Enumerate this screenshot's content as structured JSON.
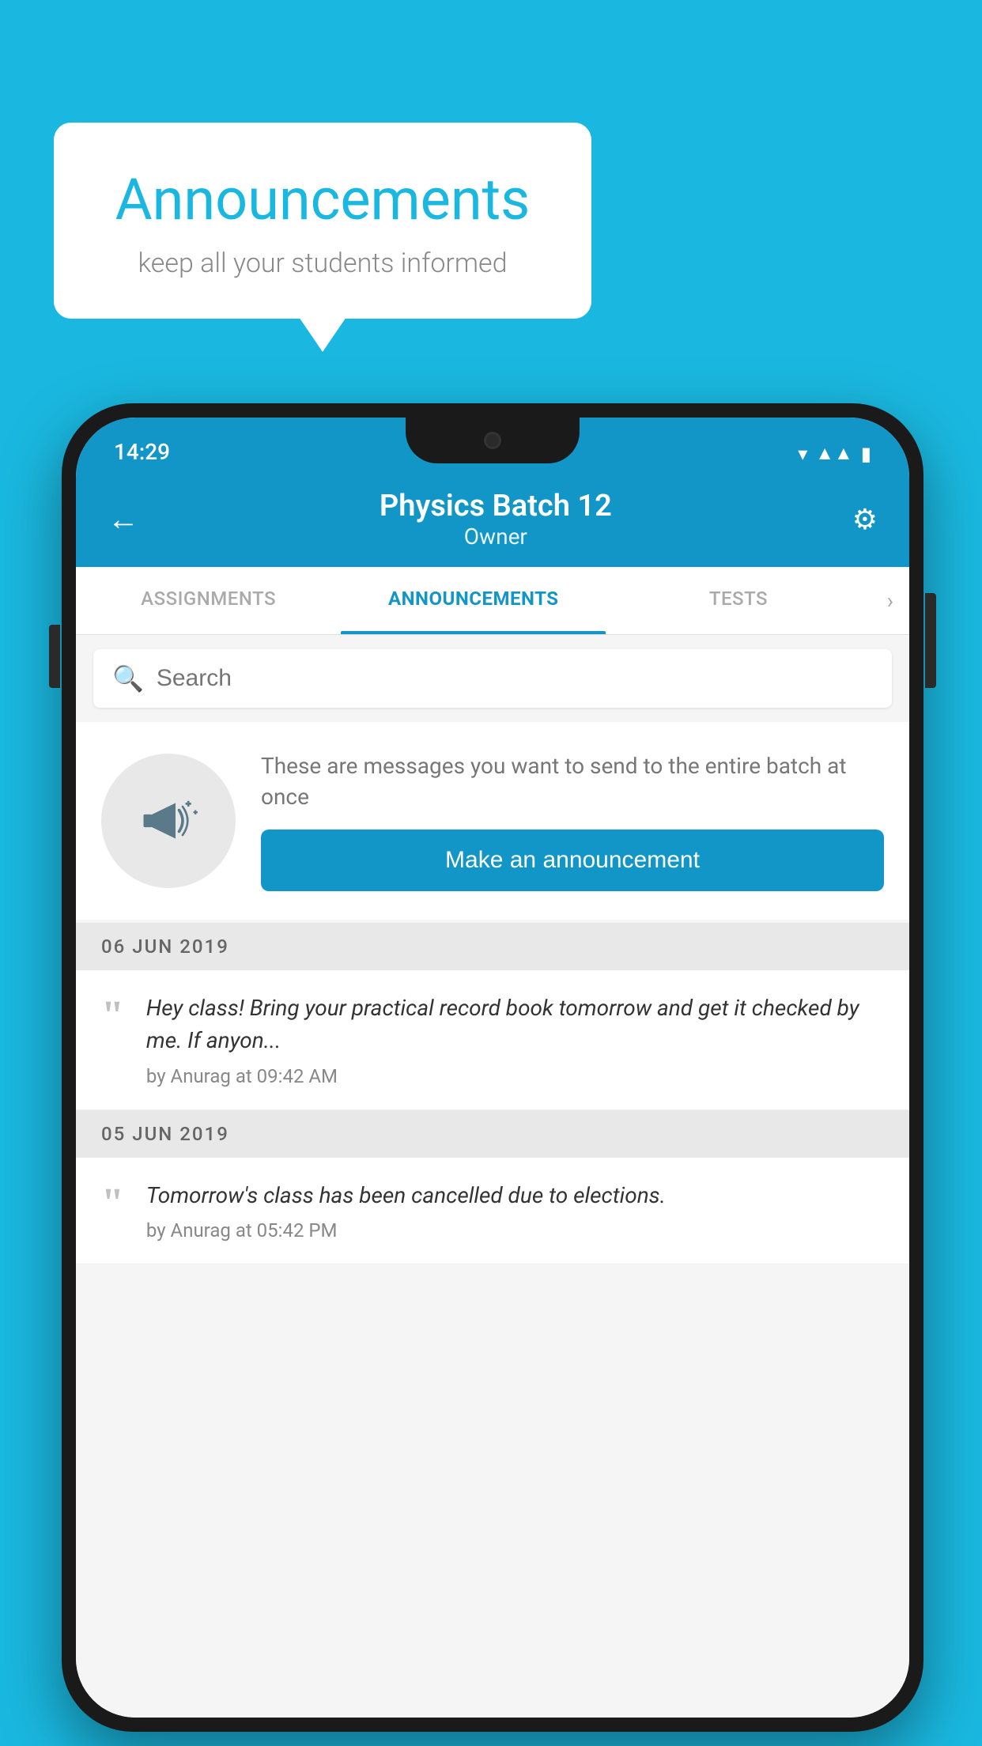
{
  "background": {
    "color": "#1ab8e0"
  },
  "speech_bubble": {
    "title": "Announcements",
    "subtitle": "keep all your students informed"
  },
  "phone": {
    "status_bar": {
      "time": "14:29"
    },
    "header": {
      "title": "Physics Batch 12",
      "subtitle": "Owner",
      "back_label": "←",
      "settings_label": "⚙"
    },
    "tabs": [
      {
        "label": "ASSIGNMENTS",
        "active": false
      },
      {
        "label": "ANNOUNCEMENTS",
        "active": true
      },
      {
        "label": "TESTS",
        "active": false
      }
    ],
    "search": {
      "placeholder": "Search"
    },
    "promo": {
      "description": "These are messages you want to send to the entire batch at once",
      "button_label": "Make an announcement"
    },
    "announcements": [
      {
        "date": "06  JUN  2019",
        "text": "Hey class! Bring your practical record book tomorrow and get it checked by me. If anyon...",
        "meta": "by Anurag at 09:42 AM"
      },
      {
        "date": "05  JUN  2019",
        "text": "Tomorrow's class has been cancelled due to elections.",
        "meta": "by Anurag at 05:42 PM"
      }
    ]
  }
}
